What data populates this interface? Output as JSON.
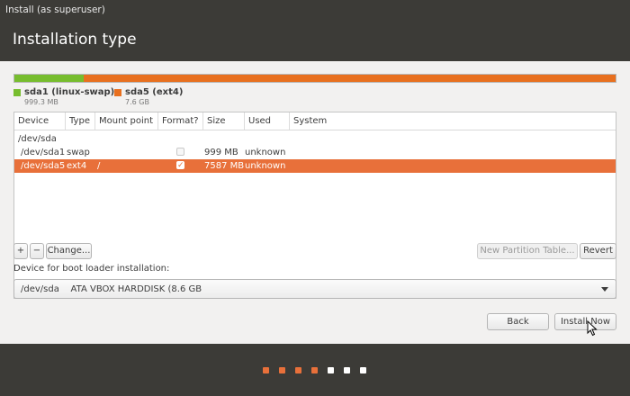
{
  "window": {
    "title": "Install (as superuser)",
    "page_title": "Installation type"
  },
  "partition_bar": {
    "segments": [
      {
        "name": "sda1 (linux-swap)",
        "size": "999.3 MB",
        "fraction": 0.116,
        "color": "#77bd2e"
      },
      {
        "name": "sda5 (ext4)",
        "size": "7.6 GB",
        "fraction": 0.884,
        "color": "#e8701f"
      }
    ]
  },
  "table": {
    "columns": [
      "Device",
      "Type",
      "Mount point",
      "Format?",
      "Size",
      "Used",
      "System"
    ],
    "rows": [
      {
        "device": "/dev/sda",
        "type": "",
        "mount": "",
        "format": null,
        "size": "",
        "used": "",
        "system": ""
      },
      {
        "device": "/dev/sda1",
        "type": "swap",
        "mount": "",
        "format": false,
        "size": "999 MB",
        "used": "unknown",
        "system": ""
      },
      {
        "device": "/dev/sda5",
        "type": "ext4",
        "mount": "/",
        "format": true,
        "size": "7587 MB",
        "used": "unknown",
        "system": "",
        "selected": true
      }
    ]
  },
  "buttons": {
    "add": "+",
    "remove": "−",
    "change": "Change...",
    "new_partition_table": "New Partition Table...",
    "revert": "Revert",
    "back": "Back",
    "install_now": "Install Now"
  },
  "bootloader": {
    "label": "Device for boot loader installation:",
    "selected": "/dev/sda    ATA VBOX HARDDISK (8.6 GB"
  },
  "progress": {
    "total_steps": 7,
    "completed_steps": 4,
    "active_color": "#e8703a",
    "inactive_color": "#ffffff"
  },
  "colors": {
    "header_bg": "#3c3b37",
    "selection": "#e8703a"
  }
}
